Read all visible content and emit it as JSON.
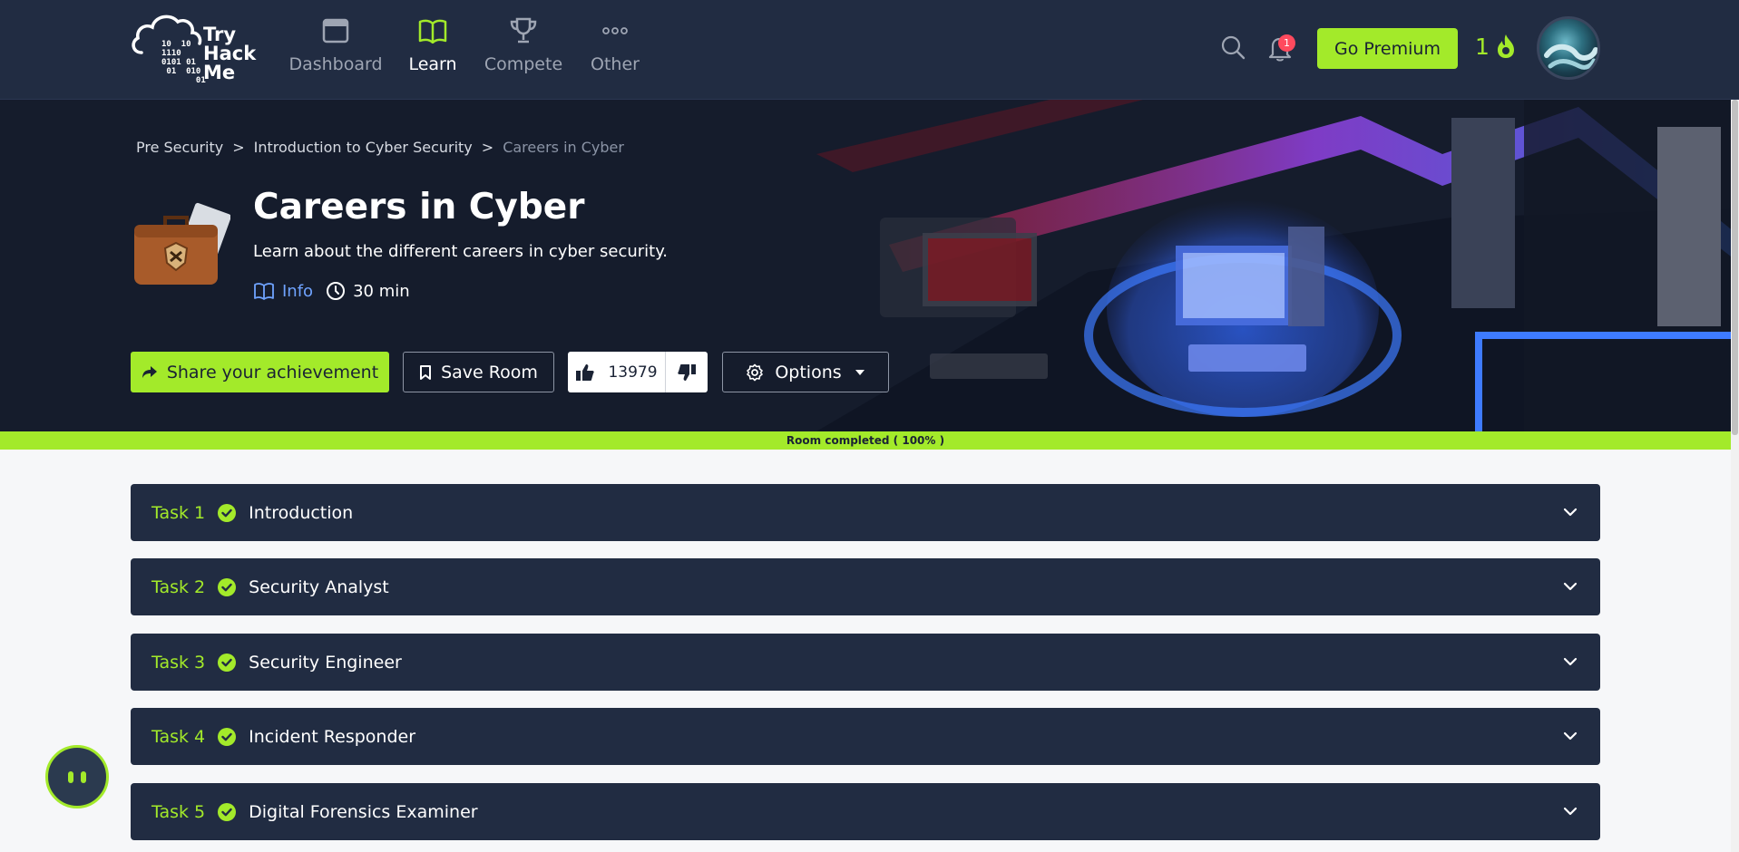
{
  "nav": {
    "brand": "Try\nHack\nMe",
    "brand_lines": [
      "Try",
      "Hack",
      "Me"
    ],
    "binary": "10  10\n1110\n0101 01\n 01  010\n       01",
    "items": [
      {
        "label": "Dashboard",
        "icon": "dashboard-icon",
        "active": false
      },
      {
        "label": "Learn",
        "icon": "book-icon",
        "active": true
      },
      {
        "label": "Compete",
        "icon": "trophy-icon",
        "active": false
      },
      {
        "label": "Other",
        "icon": "more-icon",
        "active": false
      }
    ],
    "notification_count": "1",
    "premium_label": "Go Premium",
    "streak": "1"
  },
  "hero": {
    "breadcrumb": [
      "Pre Security",
      "Introduction to Cyber Security",
      "Careers in Cyber"
    ],
    "breadcrumb_sep": ">",
    "title": "Careers in Cyber",
    "description": "Learn about the different careers in cyber security.",
    "info_label": "Info",
    "duration": "30 min",
    "share_label": "Share your achievement",
    "save_label": "Save Room",
    "likes": "13979",
    "options_label": "Options"
  },
  "progress": {
    "label": "Room completed ( 100% )",
    "percent": 100
  },
  "tasks": [
    {
      "num": "Task 1",
      "title": "Introduction",
      "done": true
    },
    {
      "num": "Task 2",
      "title": "Security Analyst",
      "done": true
    },
    {
      "num": "Task 3",
      "title": "Security Engineer",
      "done": true
    },
    {
      "num": "Task 4",
      "title": "Incident Responder",
      "done": true
    },
    {
      "num": "Task 5",
      "title": "Digital Forensics Examiner",
      "done": true
    }
  ],
  "colors": {
    "navbar": "#212c42",
    "accent": "#a3ea2a",
    "hero_bg": "#151c2c",
    "link": "#6fa3ff",
    "badge": "#ff4a5e"
  }
}
